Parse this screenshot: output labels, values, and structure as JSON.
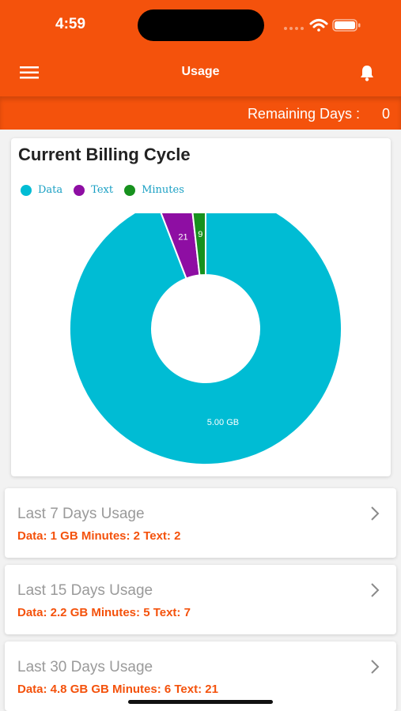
{
  "status_bar": {
    "time": "4:59"
  },
  "app_bar": {
    "title": "Usage",
    "menu_icon": "hamburger-icon",
    "notification_icon": "bell-icon"
  },
  "remaining": {
    "label": "Remaining Days :",
    "value": "0"
  },
  "billing": {
    "title": "Current Billing Cycle",
    "legend": [
      {
        "label": "Data",
        "color": "#00bcd4"
      },
      {
        "label": "Text",
        "color": "#8e0ea3"
      },
      {
        "label": "Minutes",
        "color": "#17911e"
      }
    ]
  },
  "chart_data": {
    "type": "pie",
    "donut": true,
    "categories": [
      "Data",
      "Text",
      "Minutes"
    ],
    "values": [
      95,
      4.1,
      1.8
    ],
    "data_labels": [
      "5.00 GB",
      "21",
      "9"
    ],
    "colors": [
      "#00bcd4",
      "#8e0ea3",
      "#17911e"
    ],
    "title": "Current Billing Cycle",
    "legend": "top-left"
  },
  "usage": [
    {
      "title": "Last 7 Days Usage",
      "detail": "Data: 1 GB  Minutes: 2  Text: 2"
    },
    {
      "title": "Last 15 Days Usage",
      "detail": "Data: 2.2 GB  Minutes: 5  Text: 7"
    },
    {
      "title": "Last 30 Days Usage",
      "detail": "Data: 4.8 GB GB  Minutes: 6  Text: 21"
    }
  ]
}
